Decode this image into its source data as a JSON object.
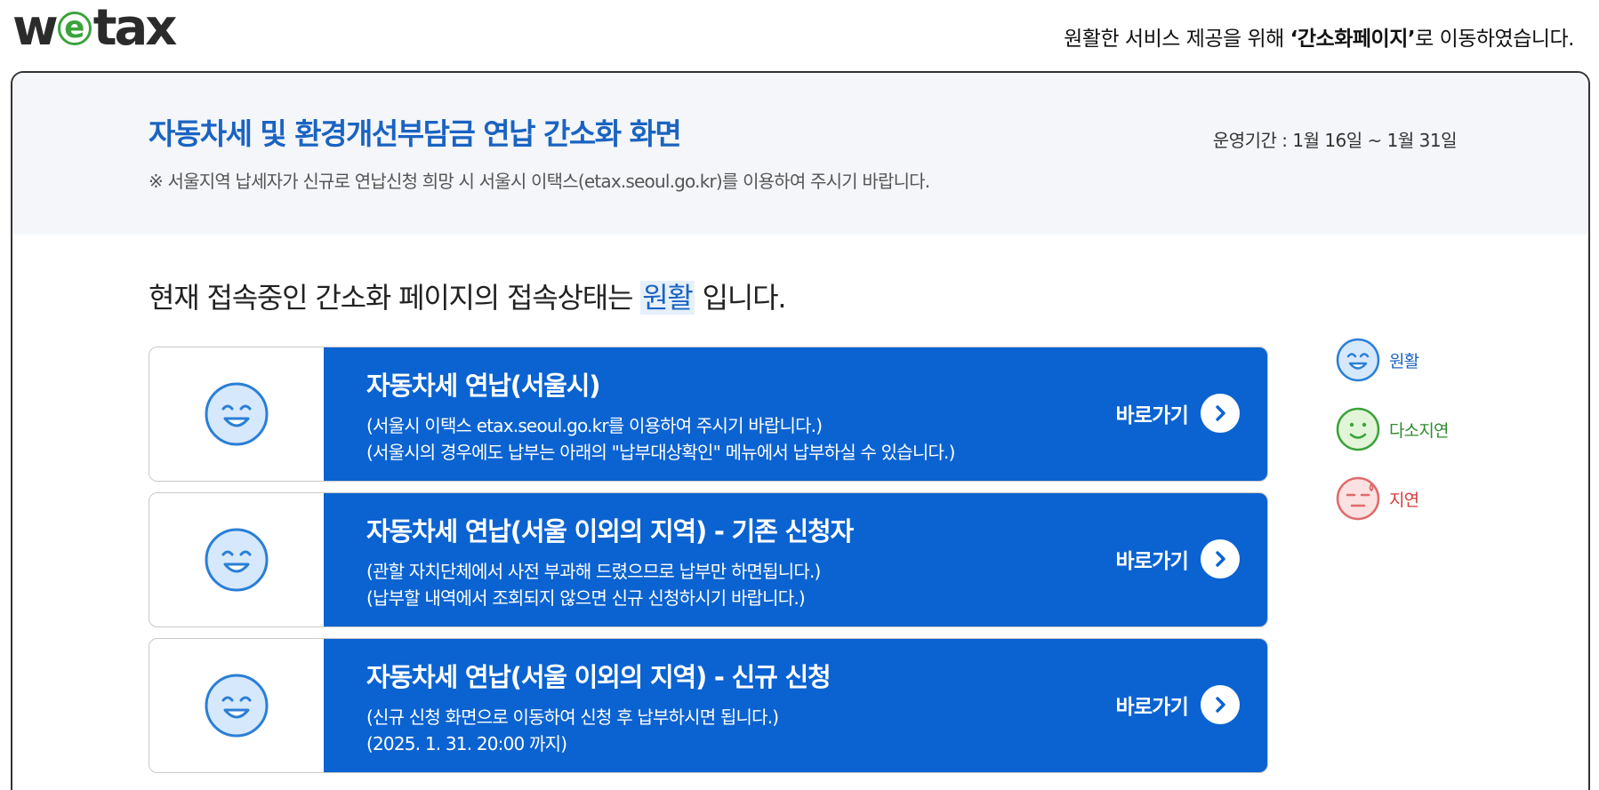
{
  "header": {
    "logo_text_1": "w",
    "logo_text_e": "e",
    "logo_text_2": "tax",
    "notice_prefix": "원활한 서비스 제공을 위해 ",
    "notice_bold": "‘간소화페이지’",
    "notice_suffix": "로 이동하였습니다."
  },
  "hero": {
    "title": "자동차세 및 환경개선부담금 연납 간소화 화면",
    "period": "운영기간 : 1월 16일 ~ 1월 31일",
    "note": "※ 서울지역 납세자가 신규로 연납신청 희망 시 서울시 이택스(etax.seoul.go.kr)를 이용하여 주시기 바랍니다."
  },
  "status": {
    "prefix": "현재 접속중인 간소화 페이지의 접속상태는 ",
    "word": "원활",
    "suffix": " 입니다."
  },
  "cards": [
    {
      "title": "자동차세 연납(서울시)",
      "line1": "(서울시 이택스 etax.seoul.go.kr를 이용하여 주시기 바랍니다.)",
      "line2": "(서울시의 경우에도 납부는 아래의 \"납부대상확인\" 메뉴에서 납부하실 수 있습니다.)",
      "go_label": "바로가기",
      "icon": "smile-face-icon"
    },
    {
      "title": "자동차세 연납(서울 이외의 지역) - 기존 신청자",
      "line1": "(관할 자치단체에서 사전 부과해 드렸으므로 납부만 하면됩니다.)",
      "line2": "(납부할 내역에서 조회되지 않으면 신규 신청하시기 바랍니다.)",
      "go_label": "바로가기",
      "icon": "smile-face-icon"
    },
    {
      "title": "자동차세 연납(서울 이외의 지역) - 신규 신청",
      "line1": "(신규 신청 화면으로 이동하여 신청 후 납부하시면 됩니다.)",
      "line2": "(2025. 1. 31. 20:00 까지)",
      "go_label": "바로가기",
      "icon": "smile-face-icon"
    }
  ],
  "legend": [
    {
      "label": "원활",
      "color": "#1a63c2",
      "fill": "#d6e8fb",
      "icon": "smile-face-icon"
    },
    {
      "label": "다소지연",
      "color": "#2e8b2e",
      "fill": "#e3f5d9",
      "icon": "neutral-face-icon"
    },
    {
      "label": "지연",
      "color": "#d63b3b",
      "fill": "#fbe1e1",
      "icon": "sad-face-icon"
    }
  ],
  "colors": {
    "brand_blue": "#0b63d1",
    "title_blue": "#1a63c2",
    "logo_green": "#3aa33a"
  }
}
